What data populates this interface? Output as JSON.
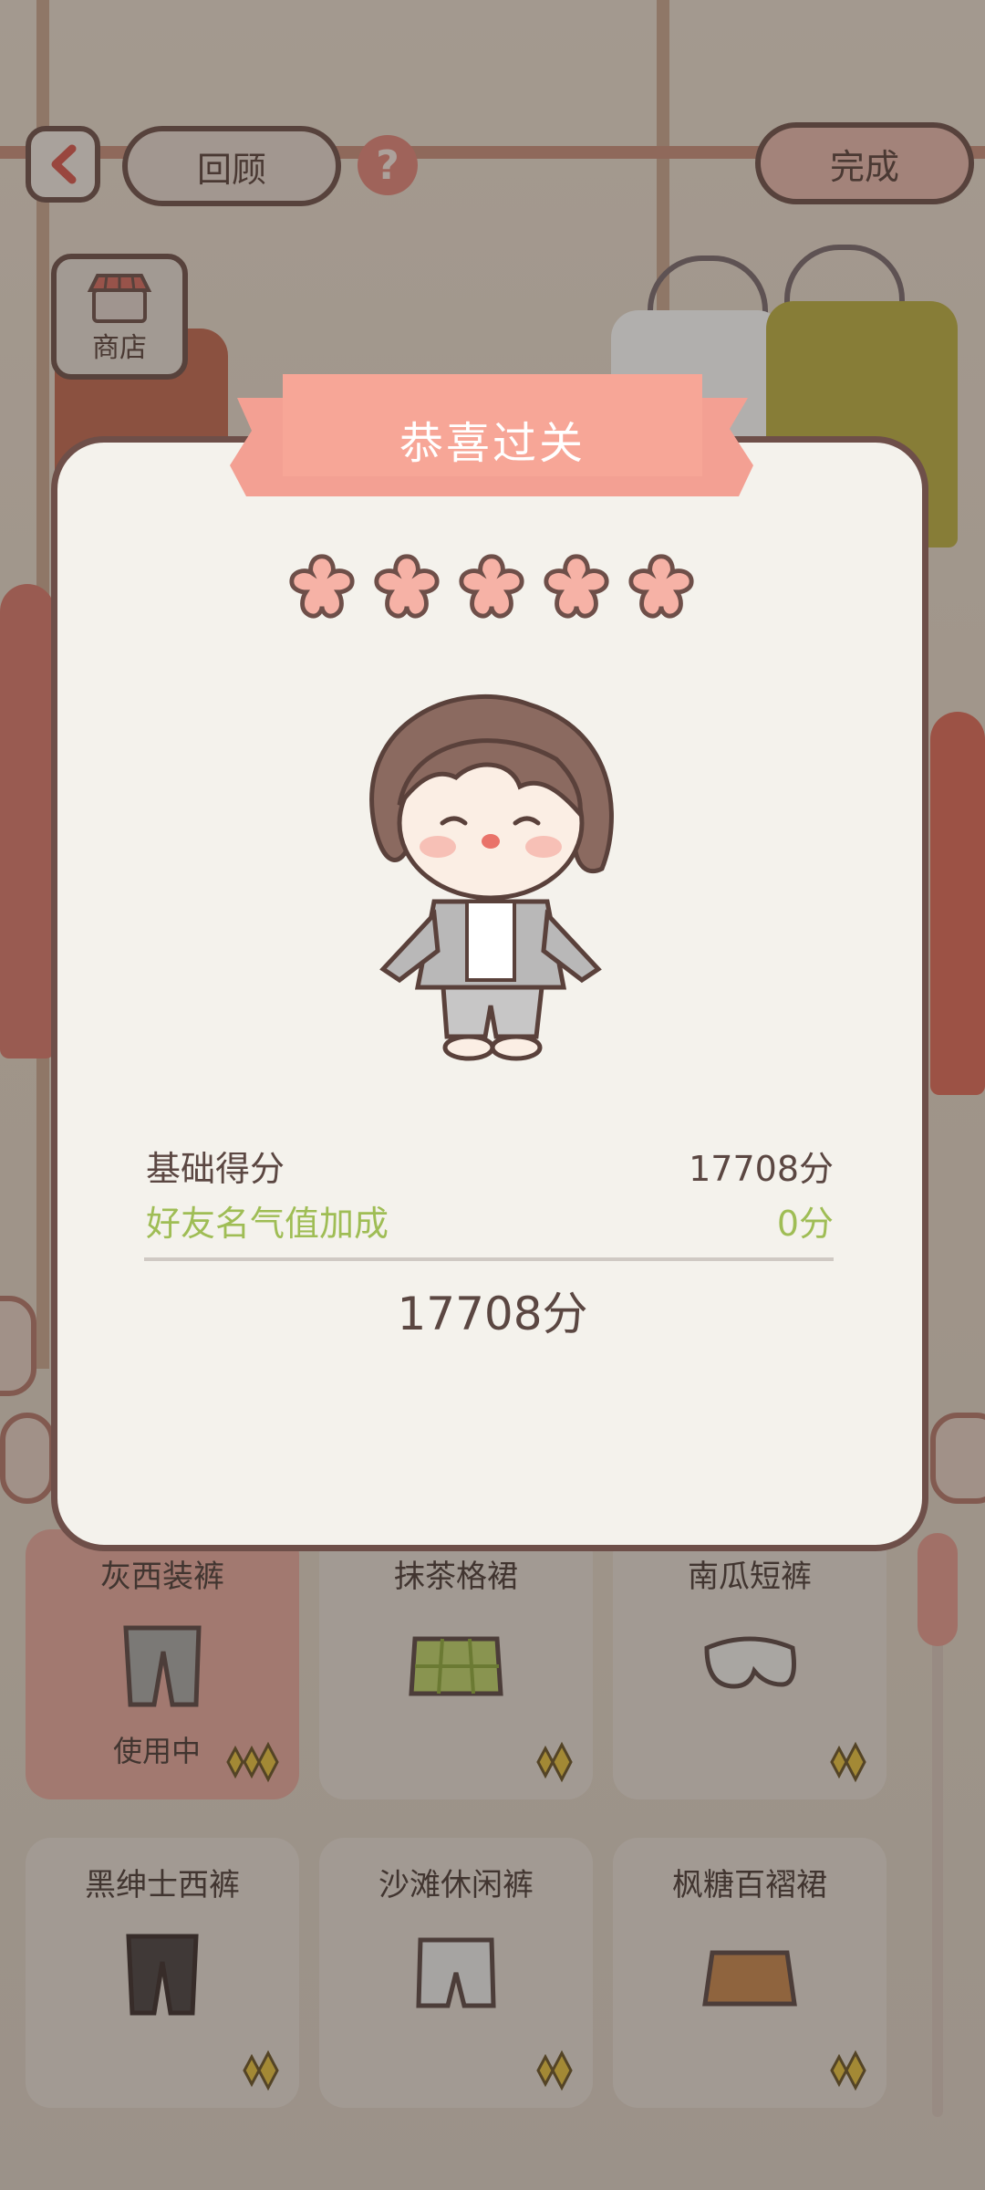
{
  "top_bar": {
    "back_icon": "chevron-left-icon",
    "review_label": "回顾",
    "help_label": "?",
    "done_label": "完成"
  },
  "shop": {
    "icon": "shop-icon",
    "label": "商店"
  },
  "modal": {
    "title": "恭喜过关",
    "stars": {
      "earned": 5,
      "total": 5
    },
    "base_score_label": "基础得分",
    "base_score_value": "17708分",
    "bonus_label": "好友名气值加成",
    "bonus_value": "0分",
    "total_value": "17708分"
  },
  "wardrobe": {
    "items": [
      {
        "name": "灰西装裤",
        "status": "使用中",
        "active": true
      },
      {
        "name": "抹茶格裙",
        "status": "",
        "active": false
      },
      {
        "name": "南瓜短裤",
        "status": "",
        "active": false
      },
      {
        "name": "黑绅士西裤",
        "status": "",
        "active": false
      },
      {
        "name": "沙滩休闲裤",
        "status": "",
        "active": false
      },
      {
        "name": "枫糖百褶裙",
        "status": "",
        "active": false
      }
    ]
  },
  "colors": {
    "accent": "#f3a093",
    "outline": "#6e4f49",
    "bonus_green": "#9fbd55",
    "active_card": "#e7a99d"
  }
}
